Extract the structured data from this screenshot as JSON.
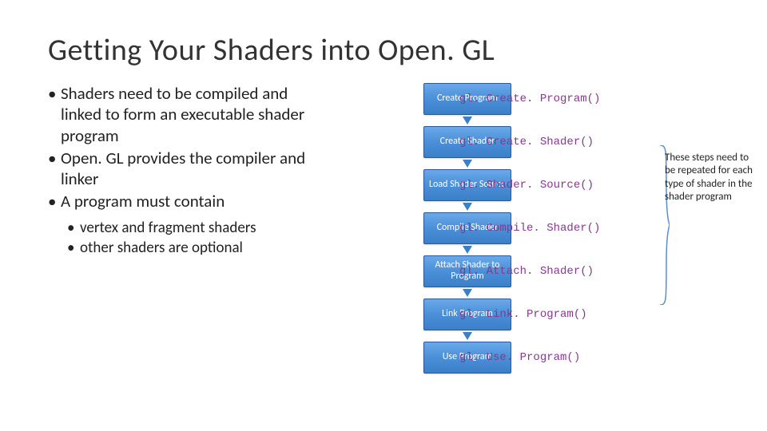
{
  "title": "Getting Your Shaders into Open. GL",
  "bullets": [
    "Shaders need to be compiled and linked to form an executable shader program",
    "Open. GL provides the compiler and linker",
    "A program must contain"
  ],
  "sub_bullets": [
    "vertex and fragment shaders",
    "other shaders are optional"
  ],
  "flow": [
    {
      "label": "Create Program",
      "fn": "gl. Create. Program()"
    },
    {
      "label": "Create Shader",
      "fn": "gl. Create. Shader()"
    },
    {
      "label": "Load Shader Source",
      "fn": "gl. Shader. Source()"
    },
    {
      "label": "Compile Shader",
      "fn": "gl. Compile. Shader()"
    },
    {
      "label": "Attach Shader to Program",
      "fn": "gl. Attach. Shader()"
    },
    {
      "label": "Link Program",
      "fn": "gl. Link. Program()"
    },
    {
      "label": "Use Program",
      "fn": "gl. Use. Program()"
    }
  ],
  "note": "These steps need to be repeated for each type of shader in the shader program"
}
